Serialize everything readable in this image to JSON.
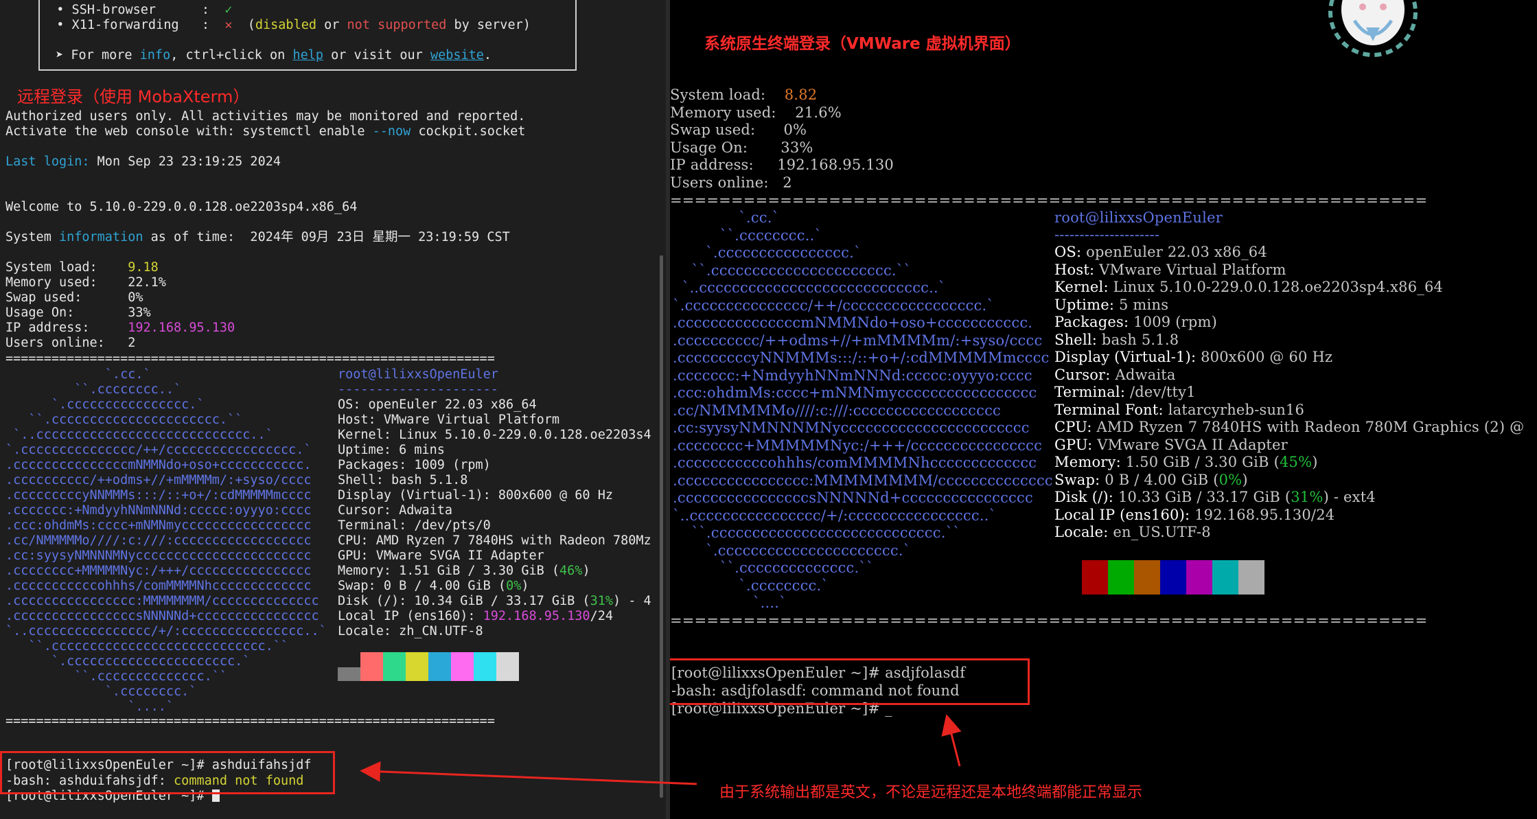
{
  "left": {
    "header_lines": [
      {
        "label": "  • SSH-browser      :  ",
        "mark": "✓"
      },
      {
        "label": "  • X11-forwarding   :  ",
        "mark": "✕",
        "note_a": "  (",
        "note_b": "disabled",
        "note_c": " or ",
        "note_d": "not supported",
        "note_e": " by server)"
      }
    ],
    "more_info": {
      "a": " ➤ For more ",
      "b": "info",
      "c": ", ctrl+click on ",
      "d": "help",
      "e": " or visit our ",
      "f": "website",
      "g": "."
    },
    "annotation_remote": "远程登录（使用 MobaXterm）",
    "auth_line": "Authorized users only. All activities may be monitored and reported.",
    "cockpit": {
      "a": "Activate the web console with: systemctl enable ",
      "b": "--now",
      "c": " cockpit.socket"
    },
    "last_login": {
      "label": "Last login:",
      "value": " Mon Sep 23 23:19:25 2024"
    },
    "welcome": "Welcome to 5.10.0-229.0.0.128.oe2203sp4.x86_64",
    "sysinfo": {
      "a": "System ",
      "b": "information",
      "c": " as of time:  2024年 09月 23日 星期一 23:19:59 CST"
    },
    "stats": [
      {
        "label": "System load:    ",
        "value": "9.18",
        "color": "yellow"
      },
      {
        "label": "Memory used:    ",
        "value": "22.1%",
        "color": "none"
      },
      {
        "label": "Swap used:      ",
        "value": "0%",
        "color": "none"
      },
      {
        "label": "Usage On:       ",
        "value": "33%",
        "color": "none"
      },
      {
        "label": "IP address:     ",
        "value": "192.168.95.130",
        "color": "magenta"
      },
      {
        "label": "Users online:   ",
        "value": "2",
        "color": "none"
      }
    ],
    "separator": "================================================================",
    "logo": [
      "             `.cc.`",
      "         ``.cccccccc..`",
      "      `.cccccccccccccccc.`",
      "   ``.cccccccccccccccccccccc.``",
      " `..cccccccccccccccccccccccccccc..`",
      "`.ccccccccccccccc/++/ccccccccccccccccc.`",
      ".cccccccccccccccmNMMNdo+oso+ccccccccccc.",
      ".cccccccccc/++odms+//+mMMMMm/:+syso/cccc",
      ".cccccccccyNNMMMs:::/::+o+/:cdMMMMMmcccc",
      ".ccccccc:+NmdyyhNNmNNNd:ccccc:oyyyo:cccc",
      ".ccc:ohdmMs:cccc+mNMNmyccccccccccccccccc",
      ".cc/NMMMMMo////:c:///:cccccccccccccccccc",
      ".cc:syysyNMNNNMNyccccccccccccccccccccccc",
      ".cccccccc+MMMMMNyc:/+++/cccccccccccccccc",
      ".cccccccccccohhhs/comMMMMNhccccccccccccc",
      ".cccccccccccccccc:MMMMMMMM/cccccccccccccc",
      ".ccccccccccccccccsNNNNNd+cccccccccccccccc",
      "`..cccccccccccccccc/+/:cccccccccccccccc..`",
      "   ``.cccccccccccccccccccccccccccc.``",
      "      `.cccccccccccccccccccccc.`",
      "         ``.cccccccccccccc.``",
      "             `.cccccccc.`",
      "                `....`"
    ],
    "neofetch_user": "root@lilixxsOpenEuler",
    "neofetch_dash": "---------------------",
    "neofetch": [
      {
        "k": "OS:",
        "v": " openEuler 22.03 x86_64"
      },
      {
        "k": "Host:",
        "v": " VMware Virtual Platform"
      },
      {
        "k": "Kernel:",
        "v": " Linux 5.10.0-229.0.0.128.oe2203s4"
      },
      {
        "k": "Uptime:",
        "v": " 6 mins"
      },
      {
        "k": "Packages:",
        "v": " 1009 (rpm)"
      },
      {
        "k": "Shell:",
        "v": " bash 5.1.8"
      },
      {
        "k": "Display (Virtual-1):",
        "v": " 800x600 @ 60 Hz"
      },
      {
        "k": "Cursor:",
        "v": " Adwaita"
      },
      {
        "k": "Terminal:",
        "v": " /dev/pts/0"
      },
      {
        "k": "CPU:",
        "v": " AMD Ryzen 7 7840HS with Radeon 780Mz"
      },
      {
        "k": "GPU:",
        "v": " VMware SVGA II Adapter"
      },
      {
        "k": "Memory:",
        "v": " 1.51 GiB / 3.30 GiB (",
        "hl": "46%",
        "tail": ")"
      },
      {
        "k": "Swap:",
        "v": " 0 B / 4.00 GiB (",
        "hl": "0%",
        "tail": ")"
      },
      {
        "k": "Disk (/):",
        "v": " 10.34 GiB / 33.17 GiB (",
        "hl": "31%",
        "tail": ") - 4"
      },
      {
        "k": "Local IP (ens160):",
        "v": " ",
        "ip": "192.168.95.130",
        "tail": "/24"
      },
      {
        "k": "Locale:",
        "v": " zh_CN.UTF-8"
      }
    ],
    "palette": [
      "#7b7b7b",
      "#ff6b6b",
      "#2fd98b",
      "#d7d72f",
      "#2aa8d8",
      "#ff6bf0",
      "#2fe0f0",
      "#d8d8d8"
    ],
    "palette_top": [
      "#1e1e1e",
      "#ff6b6b",
      "#2fd98b",
      "#d7d72f",
      "#2aa8d8",
      "#ff6bf0",
      "#2fe0f0",
      "#d8d8d8"
    ],
    "cmd_line": "[root@lilixxsOpenEuler ~]# ashduifahsjdf",
    "err": {
      "a": "-bash: ashduifahsjdf: ",
      "b": "command not found"
    },
    "prompt": "[root@lilixxsOpenEuler ~]# "
  },
  "right": {
    "annotation_native": "系统原生终端登录（VMWare 虚拟机界面）",
    "stats": [
      {
        "label": "System load:    ",
        "value": "8.82",
        "color": "orange"
      },
      {
        "label": "Memory used:    ",
        "value": "21.6%",
        "color": "none"
      },
      {
        "label": "Swap used:      ",
        "value": "0%",
        "color": "none"
      },
      {
        "label": "Usage On:       ",
        "value": "33%",
        "color": "none"
      },
      {
        "label": "IP address:     ",
        "value": "192.168.95.130",
        "color": "none"
      },
      {
        "label": "Users online:   ",
        "value": "2",
        "color": "none"
      }
    ],
    "separator": "==============================================================",
    "logo": [
      "              `.cc.`",
      "          ``.cccccccc..`",
      "       `.cccccccccccccccc.`",
      "    ``.cccccccccccccccccccccc.``",
      "  `..cccccccccccccccccccccccccccc..`",
      "`.ccccccccccccccc/++/ccccccccccccccccc.`",
      ".cccccccccccccccmNMMNdo+oso+ccccccccccc.",
      ".cccccccccc/++odms+//+mMMMMm/:+syso/cccc",
      ".cccccccccyNNMMMs:::/::+o+/:cdMMMMMmcccc",
      ".ccccccc:+NmdyyhNNmNNNd:ccccc:oyyyo:cccc",
      ".ccc:ohdmMs:cccc+mNMNmyccccccccccccccccc",
      ".cc/NMMMMMo////:c:///:cccccccccccccccccc",
      ".cc:syysyNMNNNMNyccccccccccccccccccccccc",
      ".cccccccc+MMMMMNyc:/+++/cccccccccccccccc",
      ".cccccccccccohhhs/comMMMMNhccccccccccccc",
      ".cccccccccccccccc:MMMMMMMM/cccccccccccccc",
      ".ccccccccccccccccsNNNNNd+cccccccccccccccc",
      "`..cccccccccccccccc/+/:cccccccccccccccc..`",
      "    ``.cccccccccccccccccccccccccccc.``",
      "       `.cccccccccccccccccccccc.`",
      "          ``.cccccccccccccc.``",
      "              `.cccccccc.`",
      "                 `....`"
    ],
    "neofetch_user": "root@lilixxsOpenEuler",
    "neofetch_dash": "---------------------",
    "neofetch": [
      {
        "k": "OS:",
        "v": " openEuler 22.03 x86_64"
      },
      {
        "k": "Host:",
        "v": " VMware Virtual Platform"
      },
      {
        "k": "Kernel:",
        "v": " Linux 5.10.0-229.0.0.128.oe2203sp4.x86_64"
      },
      {
        "k": "Uptime:",
        "v": " 5 mins"
      },
      {
        "k": "Packages:",
        "v": " 1009 (rpm)"
      },
      {
        "k": "Shell:",
        "v": " bash 5.1.8"
      },
      {
        "k": "Display (Virtual-1):",
        "v": " 800x600 @ 60 Hz"
      },
      {
        "k": "Cursor:",
        "v": " Adwaita"
      },
      {
        "k": "Terminal:",
        "v": " /dev/tty1"
      },
      {
        "k": "Terminal Font:",
        "v": " latarcyrheb-sun16"
      },
      {
        "k": "CPU:",
        "v": " AMD Ryzen 7 7840HS with Radeon 780M Graphics (2) @"
      },
      {
        "k": "GPU:",
        "v": " VMware SVGA II Adapter"
      },
      {
        "k": "Memory:",
        "v": " 1.50 GiB / 3.30 GiB (",
        "hl": "45%",
        "tail": ")"
      },
      {
        "k": "Swap:",
        "v": " 0 B / 4.00 GiB (",
        "hl": "0%",
        "tail": ")"
      },
      {
        "k": "Disk (/):",
        "v": " 10.33 GiB / 33.17 GiB (",
        "hl": "31%",
        "tail": ") - ext4"
      },
      {
        "k": "Local IP (ens160):",
        "v": " 192.168.95.130/24"
      },
      {
        "k": "Locale:",
        "v": " en_US.UTF-8"
      }
    ],
    "palette": [
      "#aa0000",
      "#00aa00",
      "#aa5500",
      "#0000aa",
      "#aa00aa",
      "#00aaaa",
      "#aaaaaa"
    ],
    "cmd_line": "[root@lilixxsOpenEuler ~]# asdjfolasdf",
    "err_line": "-bash: asdjfolasdf: command not found",
    "prompt": "[root@lilixxsOpenEuler ~]# _"
  },
  "annotation_bottom": "由于系统输出都是英文，不论是远程还是本地终端都能正常显示",
  "colors": {
    "accent": "#e8251f",
    "left_bg": "#1e1e1e",
    "right_bg": "#000000",
    "distro_blue": "#5f74e4"
  }
}
